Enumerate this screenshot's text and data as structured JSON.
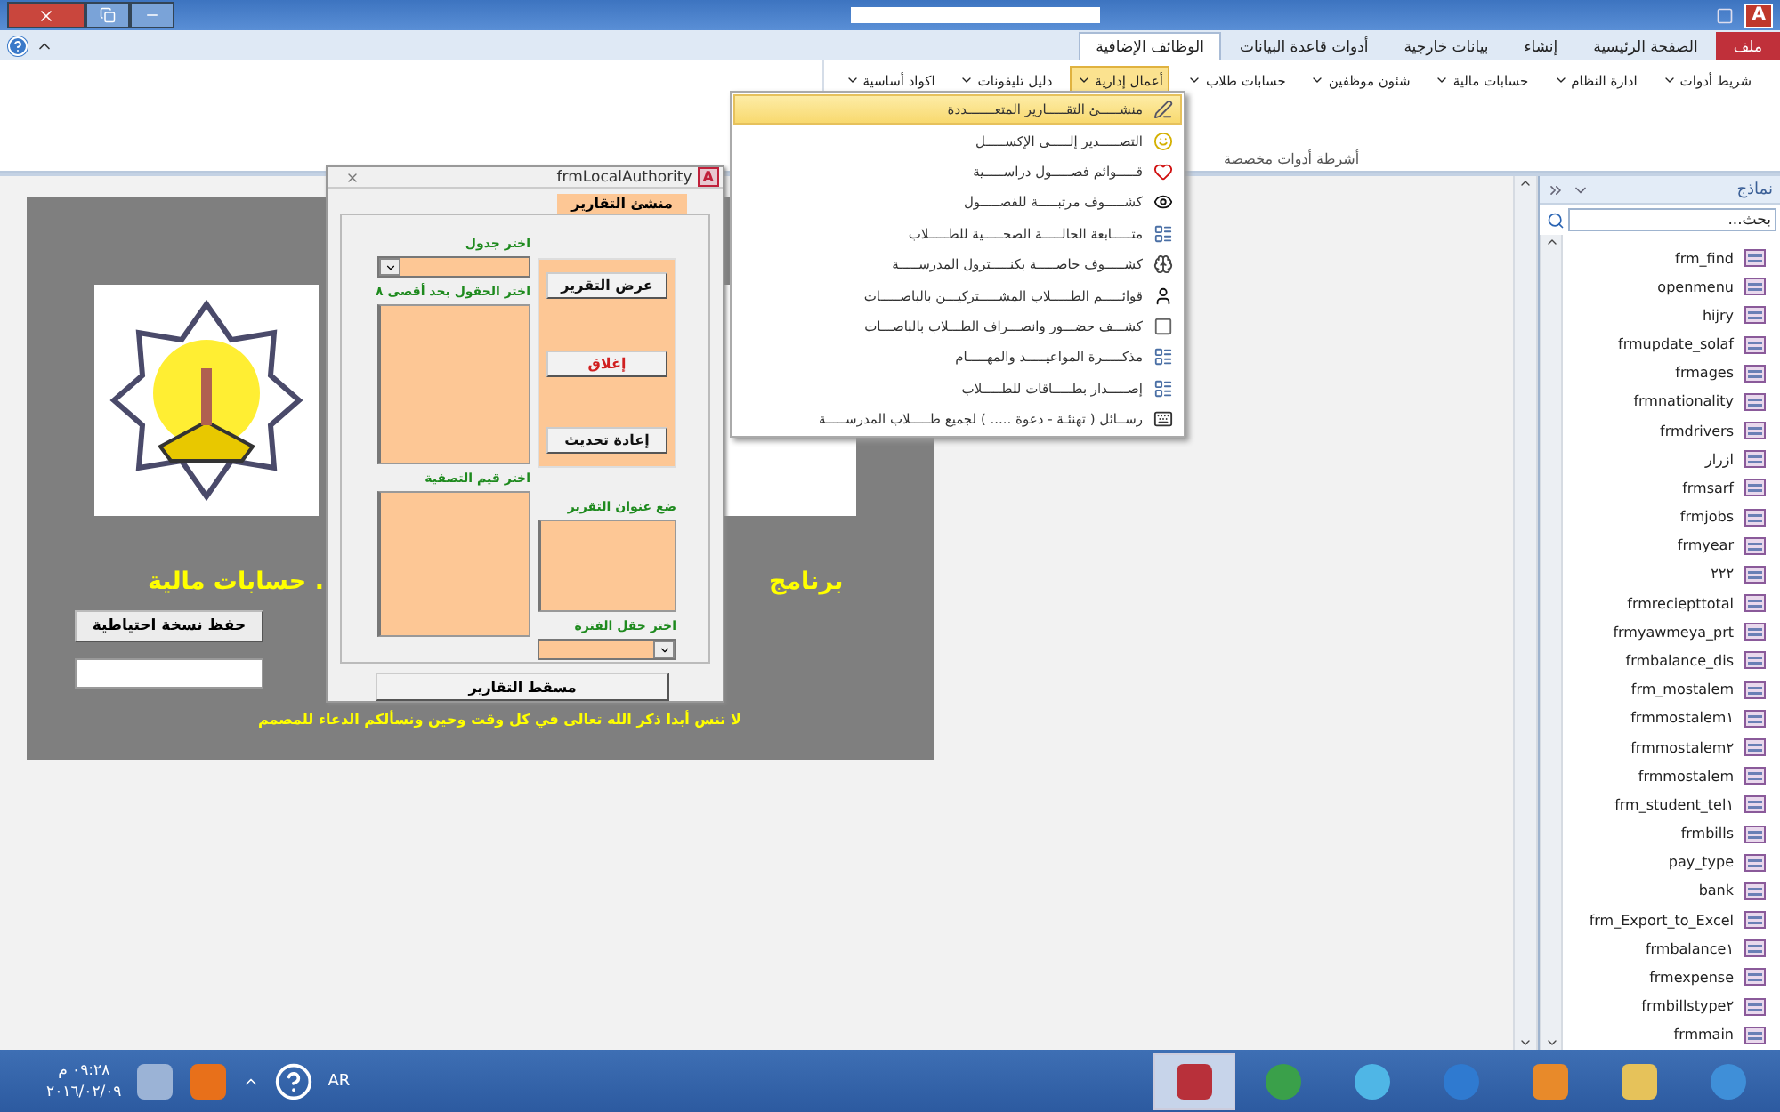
{
  "title_bar": {
    "app_letter": "A"
  },
  "ribbon": {
    "tabs": [
      {
        "label": "ملف",
        "kind": "file",
        "selected": false
      },
      {
        "label": "الصفحة الرئيسية",
        "kind": "tab",
        "selected": false
      },
      {
        "label": "إنشاء",
        "kind": "tab",
        "selected": false
      },
      {
        "label": "بيانات خارجية",
        "kind": "tab",
        "selected": false
      },
      {
        "label": "أدوات قاعدة البيانات",
        "kind": "tab",
        "selected": false
      },
      {
        "label": "الوظائف الإضافية",
        "kind": "tab",
        "selected": true
      }
    ],
    "buttons": [
      {
        "label": "شريط أدوات",
        "open": false
      },
      {
        "label": "ادارة النظام",
        "open": false
      },
      {
        "label": "حسابات مالية",
        "open": false
      },
      {
        "label": "شئون موظفين",
        "open": false
      },
      {
        "label": "حسابات طلاب",
        "open": false
      },
      {
        "label": "أعمال إدارية",
        "open": true
      },
      {
        "label": "دليل تليفونات",
        "open": false
      },
      {
        "label": "اكواد أساسية",
        "open": false
      }
    ],
    "group_label": "أشرطة أدوات مخصصة"
  },
  "menu": {
    "items": [
      {
        "label": "منشـــــئ التقـــــارير المتعـــــــددة",
        "selected": true
      },
      {
        "label": "التصـــــدير إلـــــى الإكســـــل",
        "selected": false
      },
      {
        "label": "قـــــوائم فصـــــول دراســـــية",
        "selected": false
      },
      {
        "label": "كشـــــوف مرتبـــــة للفصـــــول",
        "selected": false
      },
      {
        "label": "متـــــابعة الحالـــــة الصحـــــية للطـــــلاب",
        "selected": false
      },
      {
        "label": "كشـــــوف خاصـــــة بكنـــــترول المدرســـــة",
        "selected": false
      },
      {
        "label": "قوائـــــم الطـــــلاب المشـــــتركيـــن بالباصـــــات",
        "selected": false
      },
      {
        "label": "كشـــف حضـــور وانصـــراف الطـــلاب بالباصـــات",
        "selected": false
      },
      {
        "label": "مذكـــــرة المواعيـــــد والمهـــــام",
        "selected": false
      },
      {
        "label": "إصـــــدار بطـــــاقات للطـــــلاب",
        "selected": false
      },
      {
        "label": "رســائل ( تهنئـة - دعوة ..... ) لجميع طـــــلاب المدرســـــة",
        "selected": false
      }
    ]
  },
  "main_form": {
    "title_left": ". حسابات مالية",
    "title_right": "برنامج",
    "backup_button": "حفظ نسخة احتياطية",
    "footer": "لا تنس أبدا ذكر الله تعالى في كل وقت وحين ونسألكم الدعاء للمصمم"
  },
  "popup": {
    "title": "frmLocalAuthority",
    "app_letter": "A",
    "tab": "منشئ التقارير",
    "table_label": "اختر جدول",
    "fields_label": "اختر الحقول بحد أقصى ٨",
    "filter_label": "اختر قيم التصفية",
    "report_title_label": "ضع عنوان التقرير",
    "period_label": "اختر حقل الفترة",
    "buttons": [
      {
        "label": "عرض التقرير",
        "kind": "normal"
      },
      {
        "label": "إغلاق",
        "kind": "danger"
      },
      {
        "label": "إعادة تحديث",
        "kind": "normal"
      }
    ],
    "bottom_button": "مسقط التقارير"
  },
  "nav_pane": {
    "title": "نماذج",
    "search_placeholder": "بحث...",
    "items": [
      "frm_find",
      "openmenu",
      "hijry",
      "frmupdate_solaf",
      "frmages",
      "frmnationality",
      "frmdrivers",
      "ازرار",
      "frmsarf",
      "frmjobs",
      "frmyear",
      "٢٢٢",
      "frmreciepttotal",
      "frmyawmeya_prt",
      "frmbalance_dis",
      "frm_mostalem",
      "frmmostalem١",
      "frmmostalem٢",
      "frmmostalem",
      "frm_student_tel١",
      "frmbills",
      "pay_type",
      "bank",
      "frm_Export_to_Excel",
      "frmbalance١",
      "frmexpense",
      "frmbillstype٢",
      "frmmain"
    ]
  },
  "taskbar": {
    "language": "AR",
    "time": "٠٩:٢٨ م",
    "date": "٢٠١٦/٠٢/٠٩"
  }
}
